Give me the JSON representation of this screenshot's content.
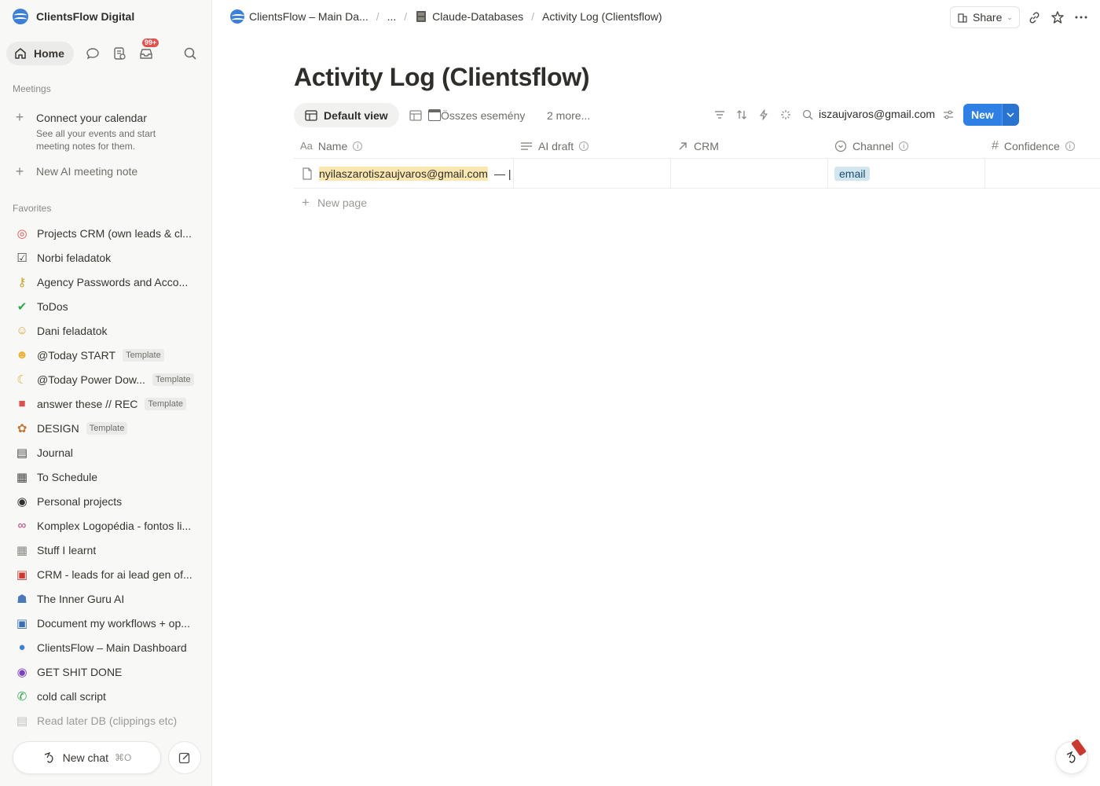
{
  "workspace": {
    "name": "ClientsFlow Digital"
  },
  "nav": {
    "home_label": "Home",
    "inbox_badge": "99+"
  },
  "meetings": {
    "section_label": "Meetings",
    "connect_title": "Connect your calendar",
    "connect_line1": "See all your events and start",
    "connect_line2": "meeting notes for them.",
    "new_note": "New AI meeting note"
  },
  "favorites": {
    "section_label": "Favorites",
    "items": [
      {
        "label": "Projects CRM (own leads & cl...",
        "icon": "target-icon",
        "template": ""
      },
      {
        "label": "Norbi feladatok",
        "icon": "checkbox-icon",
        "template": ""
      },
      {
        "label": "Agency Passwords and Acco...",
        "icon": "key-icon",
        "template": ""
      },
      {
        "label": "ToDos",
        "icon": "green-check-icon",
        "template": ""
      },
      {
        "label": "Dani feladatok",
        "icon": "cat-icon",
        "template": ""
      },
      {
        "label": "@Today START",
        "icon": "smiley-icon",
        "template": "Template"
      },
      {
        "label": "@Today Power Dow...",
        "icon": "moon-icon",
        "template": "Template"
      },
      {
        "label": "answer these // REC",
        "icon": "video-icon",
        "template": "Template"
      },
      {
        "label": "DESIGN",
        "icon": "palette-icon",
        "template": "Template"
      },
      {
        "label": "Journal",
        "icon": "notebook-icon",
        "template": ""
      },
      {
        "label": "To Schedule",
        "icon": "ledger-icon",
        "template": ""
      },
      {
        "label": "Personal projects",
        "icon": "sunglasses-icon",
        "template": ""
      },
      {
        "label": "Komplex Logopédia - fontos li...",
        "icon": "link-icon",
        "template": ""
      },
      {
        "label": "Stuff I learnt",
        "icon": "table-icon",
        "template": ""
      },
      {
        "label": "CRM - leads for ai lead gen of...",
        "icon": "inbox-tray-icon",
        "template": ""
      },
      {
        "label": "The Inner Guru AI",
        "icon": "robot-icon",
        "template": ""
      },
      {
        "label": "Document my workflows + op...",
        "icon": "chip-icon",
        "template": ""
      },
      {
        "label": "ClientsFlow – Main Dashboard",
        "icon": "clientsflow-logo-icon",
        "template": ""
      },
      {
        "label": "GET SHIT DONE",
        "icon": "eye-icon",
        "template": ""
      },
      {
        "label": "cold call script",
        "icon": "phone-icon",
        "template": ""
      },
      {
        "label": "Read later DB (clippings etc)",
        "icon": "page-icon",
        "template": ""
      }
    ]
  },
  "chat": {
    "new_chat": "New chat",
    "shortcut": "⌘O"
  },
  "breadcrumbs": {
    "item1": "ClientsFlow – Main Da...",
    "item2": "...",
    "item3": "Claude-Databases",
    "item4": "Activity Log (Clientsflow)"
  },
  "topbar": {
    "share": "Share"
  },
  "page": {
    "title": "Activity Log (Clientsflow)"
  },
  "views": {
    "default": "Default view",
    "second": "Összes esemény",
    "more": "2 more...",
    "search_value": "iszaujvaros@gmail.com",
    "new_button": "New"
  },
  "table": {
    "columns": [
      {
        "label": "Name",
        "icon": "text-icon"
      },
      {
        "label": "AI draft",
        "icon": "lines-icon"
      },
      {
        "label": "CRM",
        "icon": "relation-arrow-icon"
      },
      {
        "label": "Channel",
        "icon": "select-icon"
      },
      {
        "label": "Confidence",
        "icon": "number-icon"
      }
    ],
    "rows": [
      {
        "name": "nyilaszarotiszaujvaros@gmail.com",
        "name_suffix": "— |",
        "ai_draft": "",
        "crm": "",
        "channel": "email",
        "confidence": ""
      }
    ],
    "new_page": "New page"
  },
  "colors": {
    "accent": "#2f80e4",
    "highlight": "#fbe7b0",
    "tag_bg": "#d3e5ef",
    "badge": "#e0524b"
  }
}
